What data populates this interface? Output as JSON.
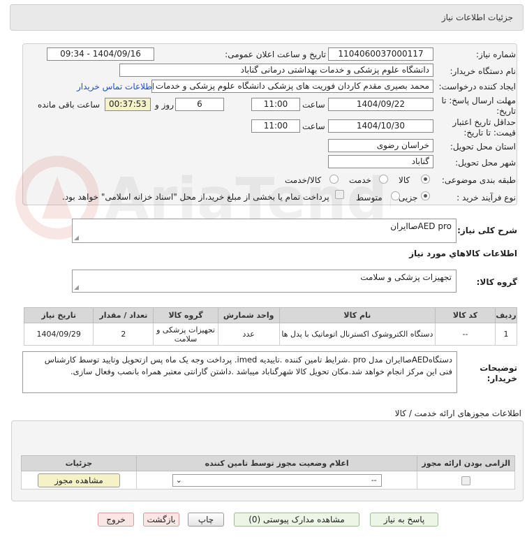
{
  "header": {
    "title": "جزئیات اطلاعات نیاز"
  },
  "form": {
    "need_number_label": "شماره نیاز:",
    "need_number": "1104060037000117",
    "announce_label": "تاریخ و ساعت اعلان عمومی:",
    "announce_value": "1404/09/16 - 09:34",
    "buyer_org_label": "نام دستگاه خریدار:",
    "buyer_org": "دانشگاه علوم پزشکی و خدمات بهداشتی درمانی گناباد",
    "creator_label": "ایجاد کننده درخواست:",
    "creator": "محمد بصیری مقدم کاردان فوریت های پزشکی دانشگاه علوم پزشکی و خدمات بهداشتی درمانی گناباد",
    "contact_link": "اطلاعات تماس خریدار",
    "deadline_label_1": "مهلت ارسال پاسخ: تا",
    "deadline_label_2": "تاریخ:",
    "deadline_date": "1404/09/22",
    "time_label": "ساعت",
    "deadline_time": "11:00",
    "days": "6",
    "day_and_label": "روز و",
    "remaining": "00:37:53",
    "remaining_label": "ساعت باقی مانده",
    "validity_label_1": "حداقل تاریخ اعتبار",
    "validity_label_2": "قیمت: تا تاریخ:",
    "validity_date": "1404/10/30",
    "validity_time": "11:00",
    "province_label": "استان محل تحویل:",
    "province": "خراسان رضوی",
    "city_label": "شهر محل تحویل:",
    "city": "گناباد",
    "category_label": "طبقه بندی موضوعی:",
    "category_options": [
      "کالا",
      "خدمت",
      "کالا/خدمت"
    ],
    "purchase_label": "نوع فرآیند خرید :",
    "purchase_options": [
      "جزیی",
      "متوسط"
    ],
    "purchase_note": "پرداخت تمام یا بخشی از مبلغ خرید،از محل \"اسناد خزانه اسلامی\" خواهد بود."
  },
  "need": {
    "summary_label": "شرح کلی نیاز:",
    "summary": "AED proصاایران",
    "goods_info_title": "اطلاعات کالاهاي مورد نياز",
    "group_label": "گروه کالا:",
    "group": "تجهیزات پزشکی و سلامت"
  },
  "goods_table": {
    "headers": [
      "ردیف",
      "کد کالا",
      "نام کالا",
      "واحد شمارش",
      "گروه کالا",
      "تعداد / مقدار",
      "تاریخ نیاز"
    ],
    "row": [
      "1",
      "--",
      "دستگاه الکتروشوک اکسترنال اتوماتیک با پدل ها",
      "عدد",
      "تجهیزات پزشکی و سلامت",
      "2",
      "1404/09/29"
    ]
  },
  "buyer_notes": {
    "label_1": "توضیحات",
    "label_2": "خریدار:",
    "line_1": "دستگاهAEDصاایران مدل pro .شرایط تامین کننده .تاییدیه imed. پرداخت وجه یک ماه پس ازتحویل وتایید توسط کارشناس",
    "line_2": "فنی این مرکز انجام خواهد شد.مکان تحویل کالا شهرگناباد میباشد .داشتن گارانتی معتبر همراه بانصب وفعال سازی."
  },
  "permits": {
    "title": "اطلاعات مجوزهای ارائه خدمت / کالا",
    "headers": [
      "الزامی بودن ارائه مجوز",
      "اعلام وضعیت مجوز توسط تامین کننده",
      "جزئیات"
    ],
    "select_value": "--",
    "view_button": "مشاهده مجوز"
  },
  "footer": {
    "reply": "پاسخ به نیاز",
    "attachments": "مشاهده مدارک پیوستی (0)",
    "print": "چاپ",
    "back": "بازگشت",
    "exit": "خروج"
  },
  "colors": {
    "link": "#1a50c8",
    "remaining_bg": "#f6f2c8",
    "watermark": "#c0392b"
  }
}
